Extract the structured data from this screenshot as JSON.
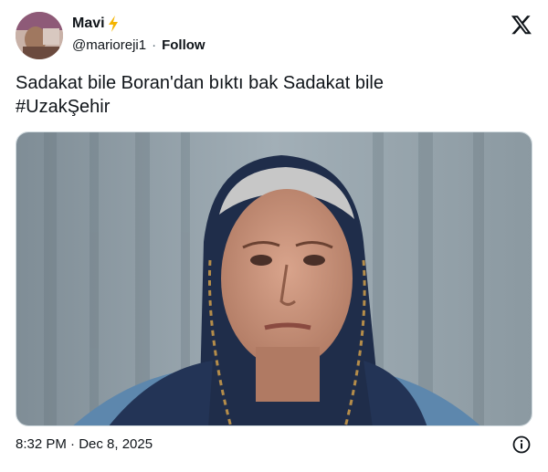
{
  "tweet": {
    "author": {
      "display_name": "Mavi",
      "handle": "@marioreji1",
      "separator": "·",
      "follow_label": "Follow",
      "badge_icon": "lightning-bolt-icon"
    },
    "text_line1": "Sadakat bile Boran'dan bıktı bak Sadakat bile",
    "text_line2": "#UzakŞehir",
    "media": {
      "description_icon": "photo"
    },
    "timestamp": "8:32 PM · Dec 8, 2025",
    "brand_icon": "x-logo-icon",
    "info_icon": "info-icon"
  },
  "colors": {
    "text": "#0f1419",
    "secondary": "#536471",
    "border": "#cfd9de",
    "bolt": "#f4b400"
  }
}
